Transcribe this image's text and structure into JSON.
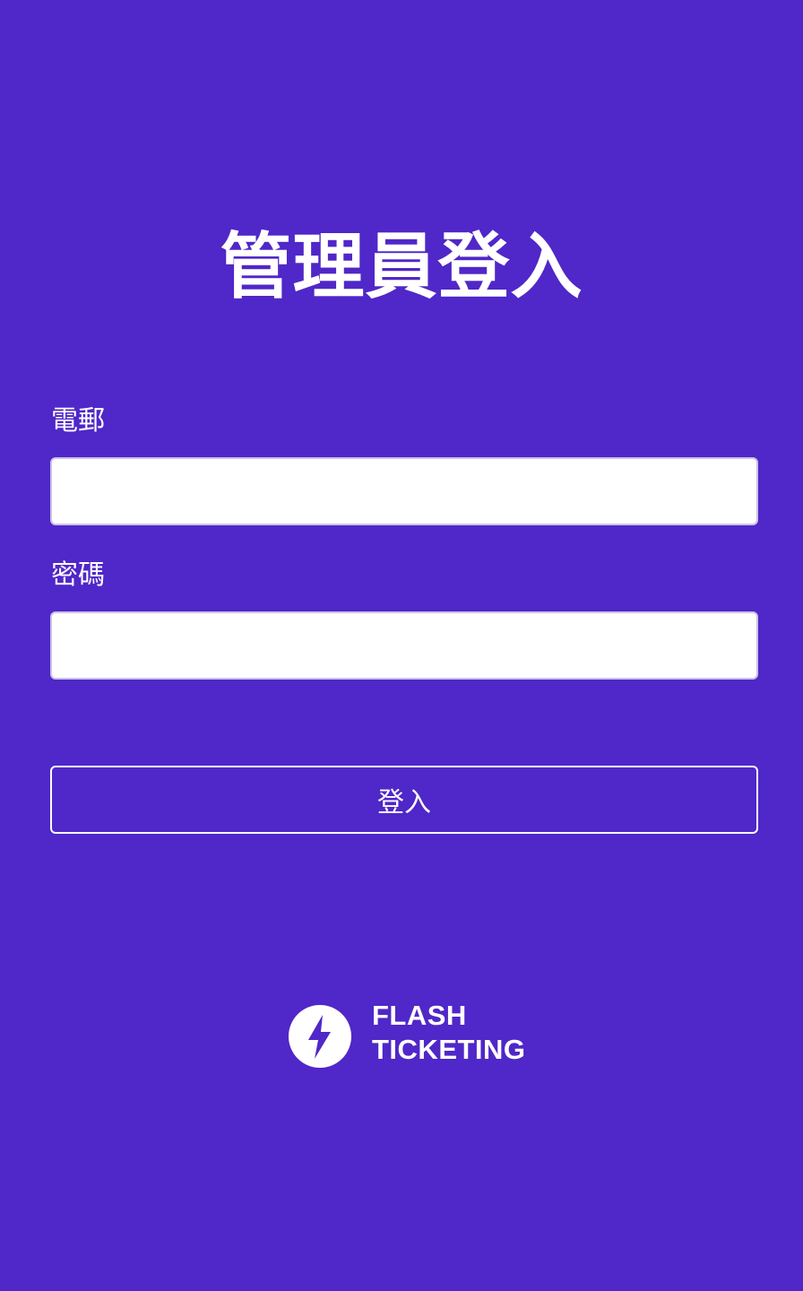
{
  "page": {
    "title": "管理員登入",
    "background_color": "#5027c8"
  },
  "form": {
    "email_label": "電郵",
    "email_value": "",
    "email_placeholder": "",
    "password_label": "密碼",
    "password_value": "",
    "password_placeholder": "",
    "submit_label": "登入"
  },
  "brand": {
    "icon": "lightning-bolt-icon",
    "line1": "FLASH",
    "line2": "TICKETING"
  }
}
